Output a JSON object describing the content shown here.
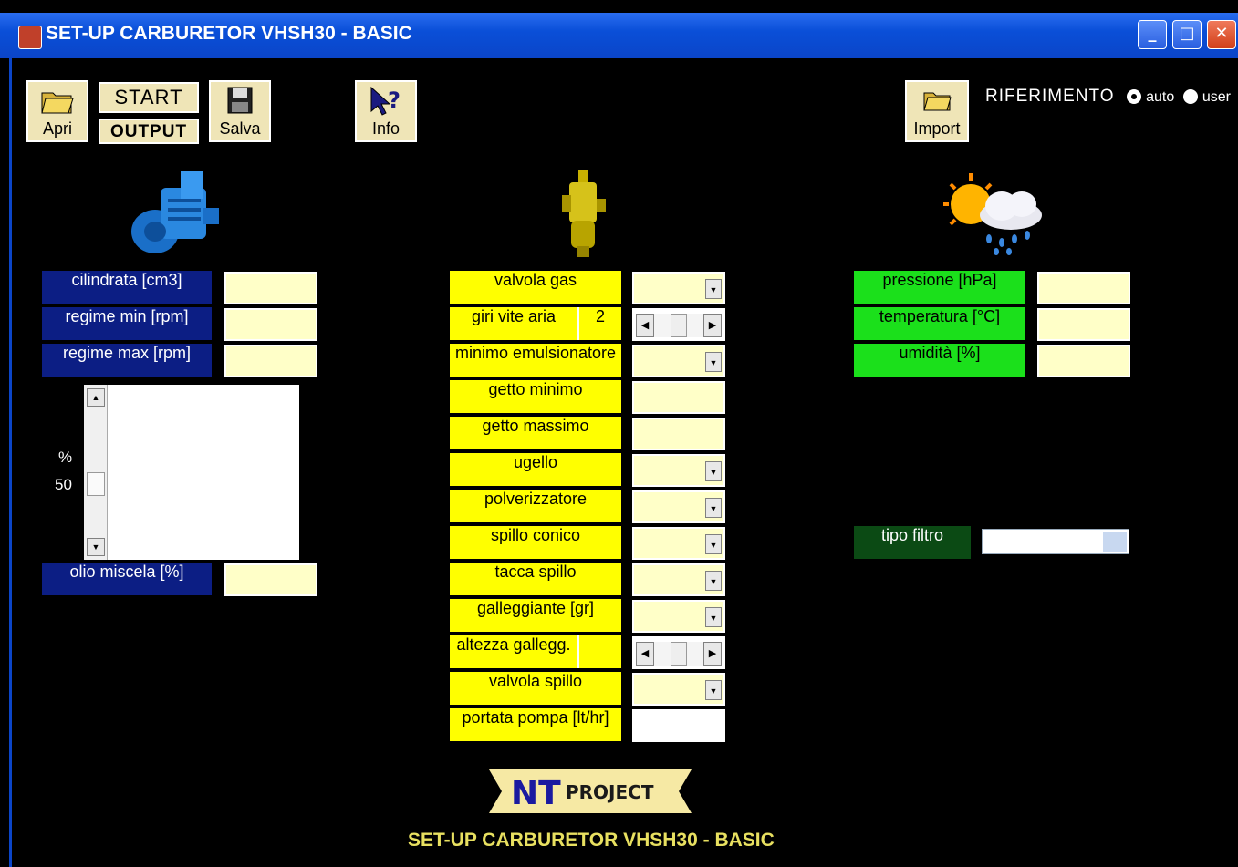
{
  "window": {
    "title": "SET-UP CARBURETOR  VHSH30 - BASIC",
    "controls": {
      "minimize": "_",
      "maximize": "□",
      "close": "✕"
    }
  },
  "toolbar": {
    "open_label": "Apri",
    "start_label": "START",
    "output_label": "OUTPUT",
    "save_label": "Salva",
    "info_label": "Info",
    "import_label": "Import"
  },
  "riferimento": {
    "label": "RIFERIMENTO",
    "options": [
      "auto",
      "user"
    ],
    "selected": "auto"
  },
  "engine": {
    "fields": [
      {
        "label": "cilindrata [cm3]",
        "value": ""
      },
      {
        "label": "regime min [rpm]",
        "value": ""
      },
      {
        "label": "regime max [rpm]",
        "value": ""
      }
    ],
    "scroll_unit": "%",
    "scroll_value": "50",
    "oil": {
      "label": "olio miscela [%]",
      "value": ""
    }
  },
  "carburetor": {
    "valvola_gas": "valvola gas",
    "giri_vite_aria": "giri vite aria",
    "giri_vite_aria_value": "2",
    "minimo_emulsionatore": "minimo emulsionatore",
    "getto_minimo": "getto minimo",
    "getto_massimo": "getto massimo",
    "ugello": "ugello",
    "polverizzatore": "polverizzatore",
    "spillo_conico": "spillo conico",
    "tacca_spillo": "tacca spillo",
    "galleggiante": "galleggiante [gr]",
    "altezza_gallegg": "altezza gallegg.",
    "valvola_spillo": "valvola spillo",
    "portata_pompa": "portata pompa [lt/hr]"
  },
  "weather": {
    "pressione": "pressione [hPa]",
    "temperatura": "temperatura [°C]",
    "umidita": "umidità [%]",
    "tipo_filtro": "tipo filtro"
  },
  "footer": {
    "logo_nt": "NT",
    "logo_project": "PROJECT",
    "title": "SET-UP CARBURETOR  VHSH30 - BASIC"
  },
  "icons": [
    "folder-open-icon",
    "floppy-disk-icon",
    "help-cursor-icon",
    "import-folder-icon",
    "engine-icon",
    "carburetor-icon",
    "weather-icon"
  ],
  "colors": {
    "engine_label": "#0c1e84",
    "carb_label": "#ffff00",
    "weather_label": "#1be01b",
    "field": "#ffffc8",
    "titlebar": "#0a4fd8"
  }
}
